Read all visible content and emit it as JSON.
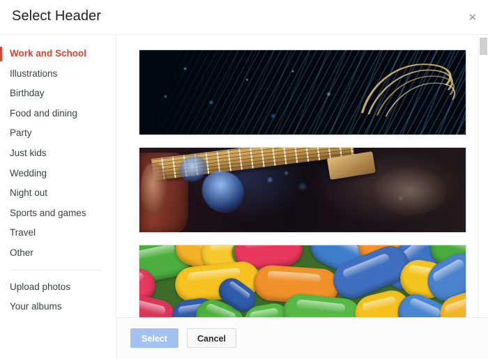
{
  "dialog": {
    "title": "Select Header",
    "close_icon": "close-icon",
    "close_glyph": "✕"
  },
  "sidebar": {
    "categories": [
      {
        "label": "Work and School",
        "active": true
      },
      {
        "label": "Illustrations",
        "active": false
      },
      {
        "label": "Birthday",
        "active": false
      },
      {
        "label": "Food and dining",
        "active": false
      },
      {
        "label": "Party",
        "active": false
      },
      {
        "label": "Just kids",
        "active": false
      },
      {
        "label": "Wedding",
        "active": false
      },
      {
        "label": "Night out",
        "active": false
      },
      {
        "label": "Sports and games",
        "active": false
      },
      {
        "label": "Travel",
        "active": false
      },
      {
        "label": "Other",
        "active": false
      }
    ],
    "secondary": [
      {
        "label": "Upload photos"
      },
      {
        "label": "Your albums"
      }
    ],
    "active_color": "#d9432f",
    "text_color": "#3c4043"
  },
  "gallery": {
    "thumbnails": [
      {
        "name": "header-thumbnail-fiber-optics",
        "description": "Dark blue fiber optic cables with diagonal light streaks",
        "selected": false
      },
      {
        "name": "header-thumbnail-guitar",
        "description": "Hands playing an electric guitar neck under blue stage light",
        "selected": false
      },
      {
        "name": "header-thumbnail-candy",
        "description": "Close-up of colorful candy jelly beans",
        "selected": false
      }
    ]
  },
  "scrollbar": {
    "name": "gallery-scrollbar",
    "thumb_name": "gallery-scrollbar-thumb"
  },
  "footer": {
    "select_label": "Select",
    "cancel_label": "Cancel",
    "select_enabled": false,
    "select_color": "#a3c2f2",
    "cancel_color": "#f8f8f8"
  }
}
